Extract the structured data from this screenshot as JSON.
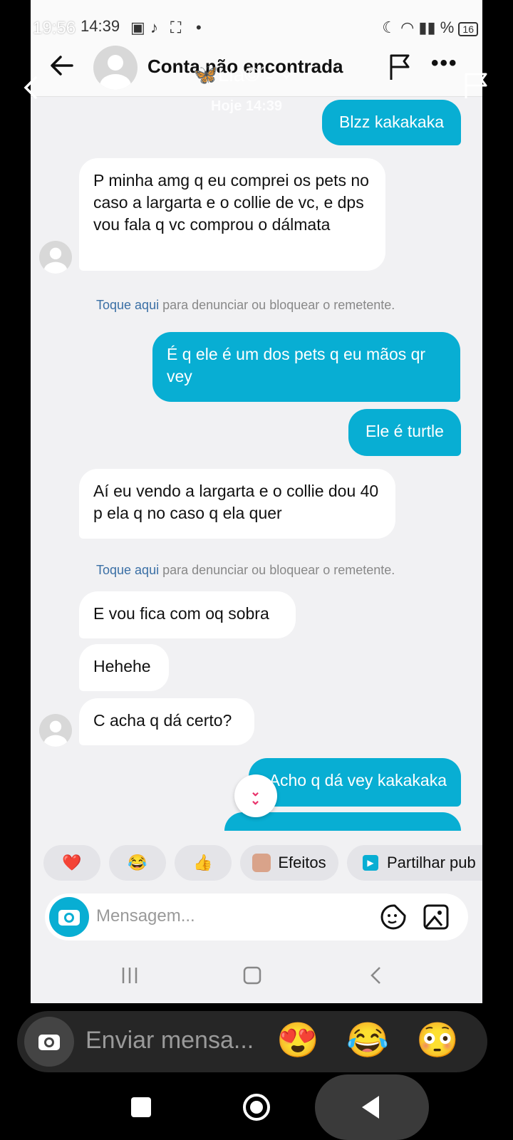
{
  "status_bar": {
    "time": "19:56",
    "time_secondary": "14:39",
    "battery": "16",
    "signal_text": "%"
  },
  "header": {
    "contact_name": "Conta não encontrada",
    "overlay_name": "🦋Lia©ˊ˗ ✧",
    "overlay_date": "Hoje 14:39"
  },
  "messages": [
    {
      "dir": "out",
      "text": "Blzz kakakaka"
    },
    {
      "dir": "in",
      "text": "P minha amg q eu comprei os pets no caso a largarta e o collie de vc, e dps vou fala q vc comprou o dálmata"
    },
    {
      "dir": "out",
      "text": "É q ele é um dos pets q eu mãos qr vey"
    },
    {
      "dir": "out",
      "text": "Ele é turtle"
    },
    {
      "dir": "in",
      "text": "Aí eu vendo a largarta e o collie dou 40 p ela q no caso q ela quer"
    },
    {
      "dir": "in",
      "text": "E vou fica com oq sobra"
    },
    {
      "dir": "in",
      "text": "Hehehe"
    },
    {
      "dir": "in",
      "text": "C acha q dá certo?"
    },
    {
      "dir": "out",
      "text": "Acho q dá vey kakakaka"
    }
  ],
  "report_notice": {
    "link": "Toque aqui",
    "rest": " para denunciar ou bloquear o remetente."
  },
  "quick_replies": {
    "heart": "❤️",
    "laugh": "😂",
    "thumbs": "👍",
    "effects_label": "Efeitos",
    "share_label": "Partilhar pub"
  },
  "composer": {
    "placeholder": "Mensagem..."
  },
  "outer_composer": {
    "placeholder": "Enviar mensa...",
    "emojis": [
      "😍",
      "😂",
      "😳"
    ]
  },
  "colors": {
    "outgoing_bubble": "#08aed3",
    "incoming_bubble": "#ffffff",
    "background": "#f1f1f3"
  }
}
